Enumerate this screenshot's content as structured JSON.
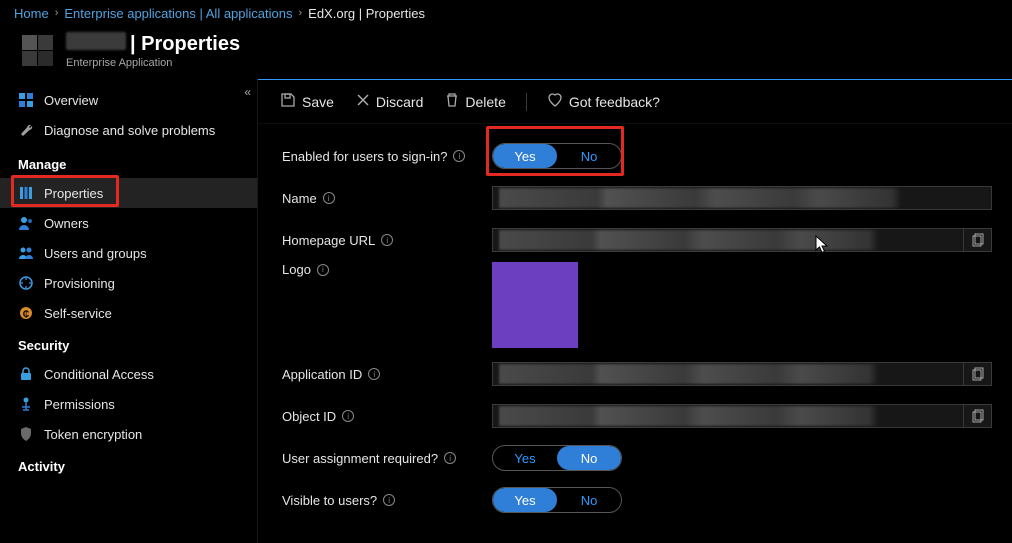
{
  "breadcrumbs": {
    "home": "Home",
    "seg1": "Enterprise applications | All applications",
    "seg2": "EdX.org | Properties"
  },
  "header": {
    "title_suffix": "| Properties",
    "subtitle": "Enterprise Application"
  },
  "toolbar": {
    "save": "Save",
    "discard": "Discard",
    "delete": "Delete",
    "feedback": "Got feedback?"
  },
  "sidebar": {
    "overview": "Overview",
    "diagnose": "Diagnose and solve problems",
    "sec_manage": "Manage",
    "properties": "Properties",
    "owners": "Owners",
    "users_groups": "Users and groups",
    "provisioning": "Provisioning",
    "self_service": "Self-service",
    "sec_security": "Security",
    "conditional_access": "Conditional Access",
    "permissions": "Permissions",
    "token_encryption": "Token encryption",
    "sec_activity": "Activity"
  },
  "form": {
    "enabled_label": "Enabled for users to sign-in?",
    "name_label": "Name",
    "homepage_label": "Homepage URL",
    "logo_label": "Logo",
    "appid_label": "Application ID",
    "objectid_label": "Object ID",
    "user_assign_label": "User assignment required?",
    "visible_label": "Visible to users?",
    "yes": "Yes",
    "no": "No"
  },
  "values": {
    "enabled": "Yes",
    "user_assignment": "No",
    "visible": "Yes"
  }
}
